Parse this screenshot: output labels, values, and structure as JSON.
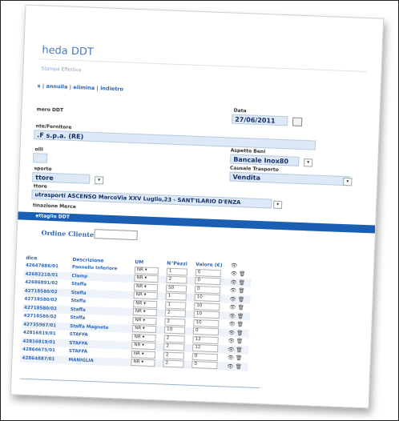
{
  "header": {
    "title": "heda DDT",
    "print_link": "Stampa Effettiva"
  },
  "actions": "s | annulla | elimina | indietro",
  "form": {
    "numero_label": "mero DDT",
    "data_label": "Data",
    "data_value": "27/06/2011",
    "cliente_label": "nte/Fornitore",
    "cliente_value": ".F s.p.a. (RE)",
    "aspetto_label": "Aspetto Beni",
    "aspetto_value": "Bancale Inox80",
    "colli_label": "olli",
    "causale_label": "Causale Trasporto",
    "causale_value": "Vendita",
    "trasporto_label": "sporto",
    "trasporto_value": "ttore",
    "vettore_label": "ttore",
    "vettore_value": "utrasporti ASCENSO MarcoVia XXV Luglio,23 - SANT'ILARIO D'ENZA",
    "destinazione_label": "tinazione Merce"
  },
  "section": {
    "title": "ettaglio DDT"
  },
  "ordine": {
    "label": "Ordine Cliente:"
  },
  "table": {
    "columns": [
      "dice",
      "Descrizione",
      "UM",
      "N°Pezzi",
      "Valore (€)"
    ],
    "rows": [
      {
        "code": "42647886/01",
        "desc": "Pannello Inferiore",
        "um": "NR",
        "pezzi": "1",
        "valore": "0"
      },
      {
        "code": "42682218/01",
        "desc": "Clamp",
        "um": "NR",
        "pezzi": "2",
        "valore": "0"
      },
      {
        "code": "42686891/02",
        "desc": "Staffa",
        "um": "NR",
        "pezzi": "50",
        "valore": "0"
      },
      {
        "code": "42718580/02",
        "desc": "Staffa",
        "um": "NR",
        "pezzi": "1",
        "valore": "10"
      },
      {
        "code": "42718580/02",
        "desc": "Staffa",
        "um": "NR",
        "pezzi": "1",
        "valore": "10"
      },
      {
        "code": "42718580/02",
        "desc": "Staffa",
        "um": "NR",
        "pezzi": "2",
        "valore": "10"
      },
      {
        "code": "42718580/02",
        "desc": "Staffa",
        "um": "NR",
        "pezzi": "2",
        "valore": "10"
      },
      {
        "code": "42735967/01",
        "desc": "Staffa Magnete",
        "um": "NR",
        "pezzi": "10",
        "valore": "0"
      },
      {
        "code": "42816819/01",
        "desc": "STAFFA",
        "um": "NR",
        "pezzi": "2",
        "valore": "12"
      },
      {
        "code": "42816819/01",
        "desc": "STAFFA",
        "um": "NR",
        "pezzi": "2",
        "valore": "12"
      },
      {
        "code": "42864675/01",
        "desc": "STAFFA",
        "um": "NR",
        "pezzi": "2",
        "valore": "0"
      },
      {
        "code": "42864887/01",
        "desc": "MANIGLIA",
        "um": "NR",
        "pezzi": "2",
        "valore": "0"
      }
    ]
  },
  "icons": {
    "view": "eye-icon",
    "delete": "trash-icon"
  },
  "colors": {
    "accent": "#1a5fb4",
    "field_bg": "#dde9f6",
    "link": "#2f67b2"
  }
}
